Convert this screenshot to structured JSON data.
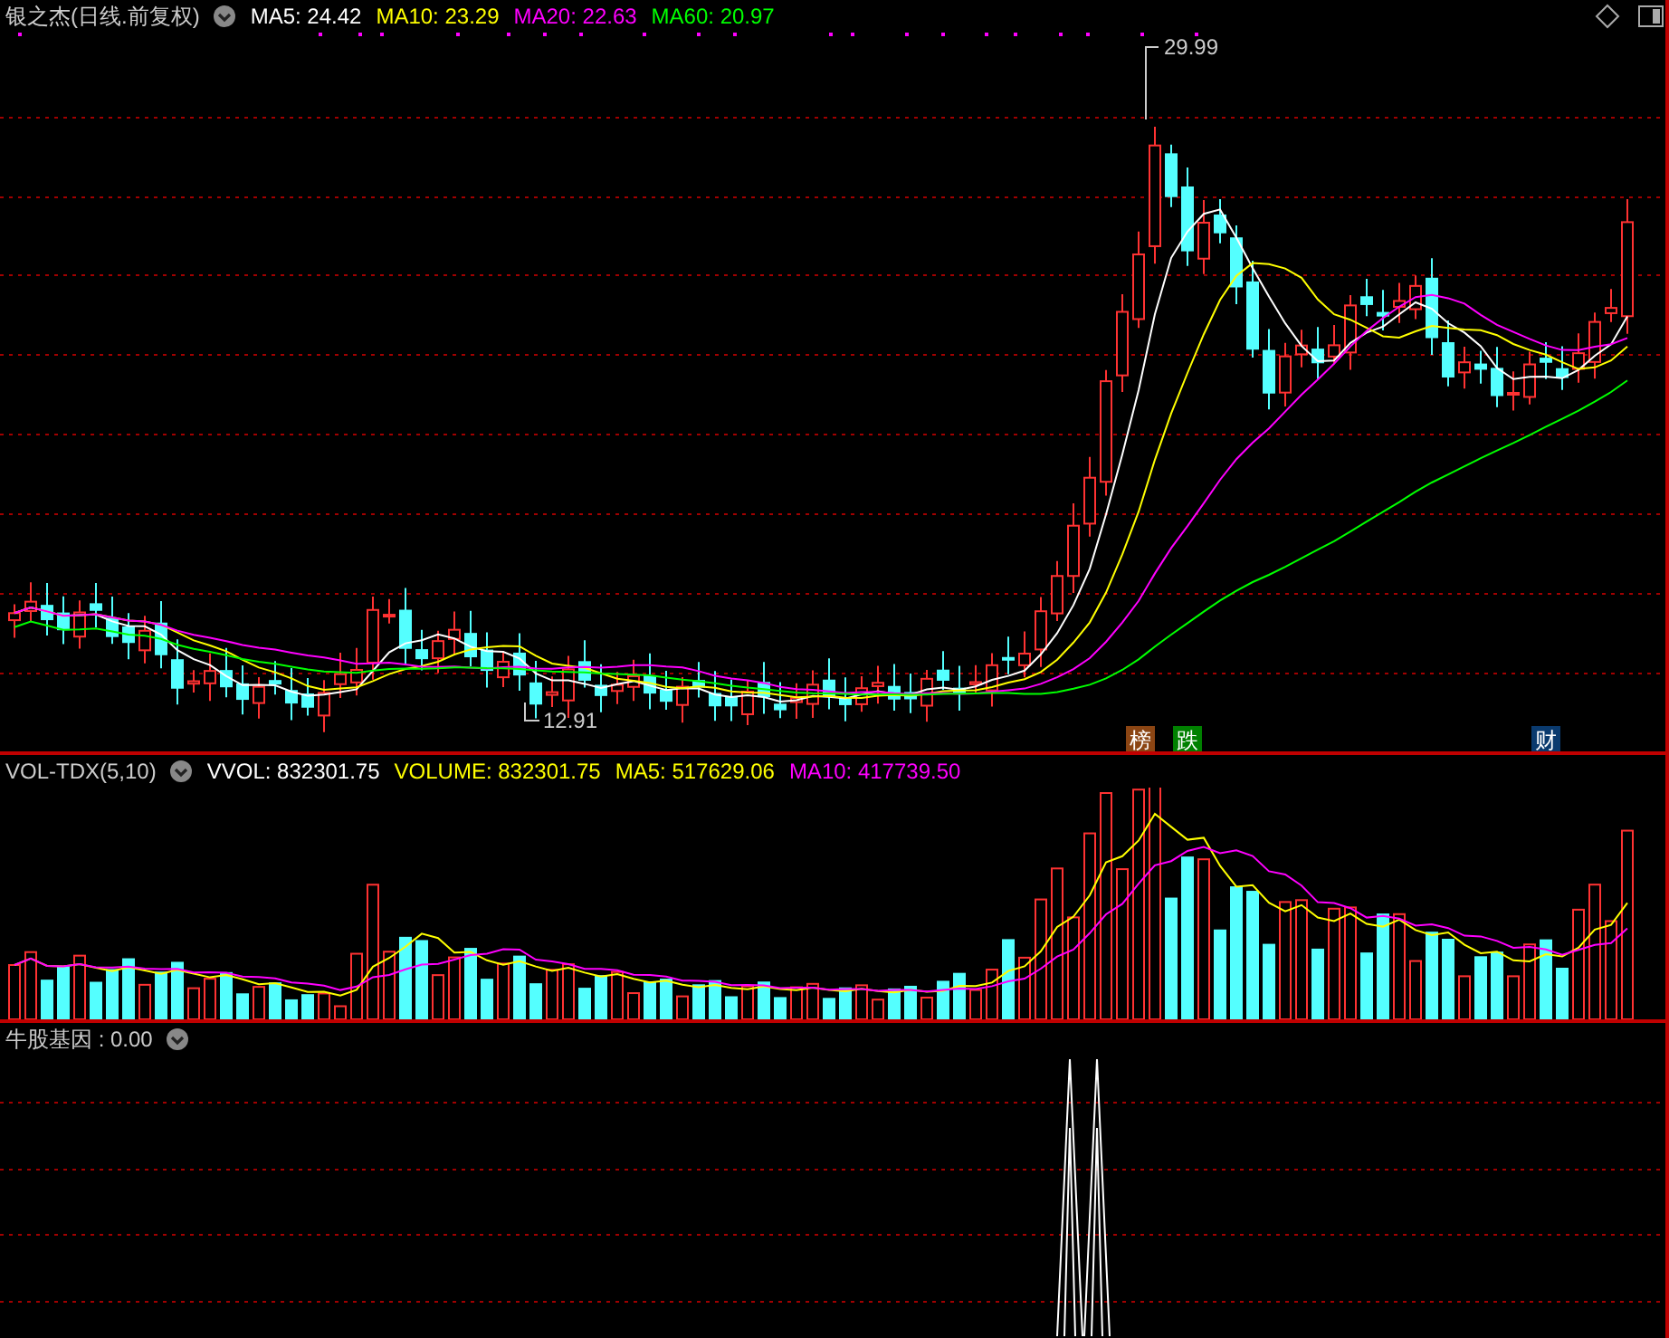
{
  "price_panel": {
    "title": "银之杰(日线.前复权)",
    "indicators": [
      {
        "label": "MA5: 24.42",
        "color": "#ffffff"
      },
      {
        "label": "MA10: 23.29",
        "color": "#ffff00"
      },
      {
        "label": "MA20: 22.63",
        "color": "#ff00ff"
      },
      {
        "label": "MA60: 20.97",
        "color": "#00ff00"
      }
    ],
    "high_label": "29.99",
    "low_label": "12.91",
    "event_tags": [
      {
        "text": "榜",
        "color": "#8b4513"
      },
      {
        "text": "跌",
        "color": "#008000"
      },
      {
        "text": "财",
        "color": "#0a3a6e"
      }
    ]
  },
  "volume_panel": {
    "title": "VOL-TDX(5,10)",
    "indicators": [
      {
        "label": "VVOL: 832301.75",
        "color": "#ffffff"
      },
      {
        "label": "VOLUME: 832301.75",
        "color": "#ffff00"
      },
      {
        "label": "MA5: 517629.06",
        "color": "#ffff00"
      },
      {
        "label": "MA10: 417739.50",
        "color": "#ff00ff"
      }
    ]
  },
  "indicator_panel": {
    "title": "牛股基因 : 0.00"
  }
}
